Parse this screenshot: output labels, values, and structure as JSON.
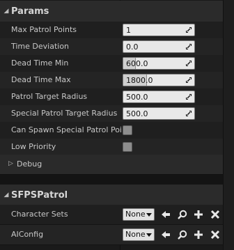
{
  "params": {
    "title": "Params",
    "rows": [
      {
        "label": "Max Patrol Points",
        "value": "1",
        "fill_percent": 0
      },
      {
        "label": "Time Deviation",
        "value": "0.0",
        "fill_percent": 0
      },
      {
        "label": "Dead Time Min",
        "value": "600.0",
        "fill_percent": 17
      },
      {
        "label": "Dead Time Max",
        "value": "1800.0",
        "fill_percent": 32
      },
      {
        "label": "Patrol Target Radius",
        "value": "500.0",
        "fill_percent": 0
      },
      {
        "label": "Special Patrol Target Radius",
        "value": "500.0",
        "fill_percent": 0
      }
    ],
    "checks": [
      {
        "label": "Can Spawn Special Patrol Point"
      },
      {
        "label": "Low Priority"
      }
    ],
    "debug_label": "Debug"
  },
  "sfps": {
    "title": "SFPSPatrol",
    "rows": [
      {
        "label": "Character Sets",
        "combo": "None"
      },
      {
        "label": "AIConfig",
        "combo": "None"
      }
    ]
  },
  "colors": {
    "accent_icon": "#e8e8e8"
  },
  "icons": {
    "use_selected": "arrow-left-icon",
    "browse": "magnifier-icon",
    "add": "plus-icon",
    "clear": "x-icon"
  }
}
